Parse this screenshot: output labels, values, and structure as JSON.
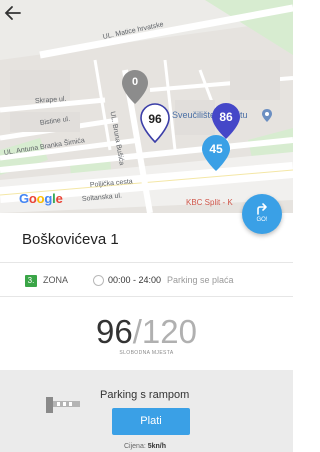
{
  "map": {
    "streets": {
      "matice": "UL. Matice hrvatske",
      "skrape": "Skrape ul.",
      "bistine": "Bistine ul.",
      "branka_simica": "UL. Antuna Branka Šimića",
      "bruna_busica": "UL. Bruna Bušića",
      "poljicka": "Poljička cesta",
      "soltanska": "Soltanska ul."
    },
    "poi_university": "Sveučilište u Splitu",
    "poi_hospital": "KBC Split - K",
    "google_logo": [
      "G",
      "o",
      "o",
      "g",
      "l",
      "e"
    ],
    "pins": [
      {
        "number": "0",
        "color": "#8c8c8c"
      },
      {
        "number": "96",
        "color": "#ffffff"
      },
      {
        "number": "86",
        "color": "#4547c8"
      },
      {
        "number": "45",
        "color": "#3aa0e6"
      }
    ]
  },
  "go_button": {
    "label": "GO!"
  },
  "location": {
    "title": "Boškovićeva 1"
  },
  "zone": {
    "number": "3.",
    "label": "ZONA",
    "hours": "00:00 - 24:00",
    "payment_note": "Parking se plaća"
  },
  "capacity": {
    "free": "96",
    "separator": "/",
    "total": "120",
    "label": "SLOBODNA MJESTA"
  },
  "parking": {
    "type": "Parking s rampom",
    "pay_button": "Plati",
    "price_label": "Cijena:",
    "price_value": "5kn/h"
  }
}
